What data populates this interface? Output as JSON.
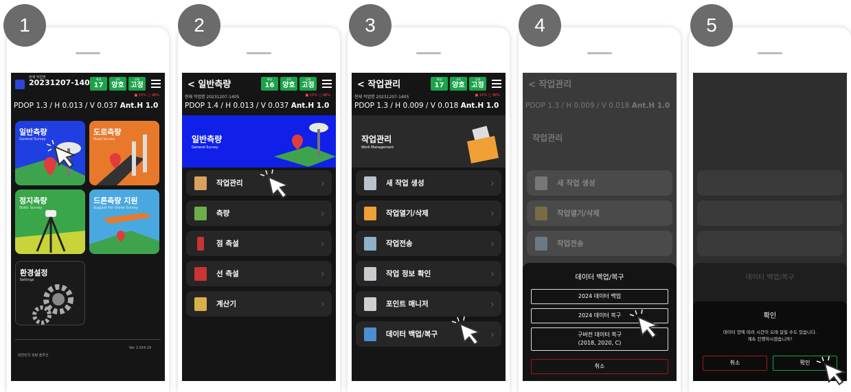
{
  "steps": [
    "1",
    "2",
    "3",
    "4",
    "5"
  ],
  "screen1": {
    "job_label": "현재 작업명",
    "job_name": "20231207-1405",
    "pdop_prefix": "PDOP 1.3 / H 0.013 / V 0.037",
    "ant": "Ant.H 1.0",
    "signal": "■ 15%  □ 98%",
    "badges": [
      {
        "top": "위성",
        "val": "17"
      },
      {
        "top": "고도",
        "val": "양호"
      },
      {
        "top": "상태",
        "val": "고정"
      }
    ],
    "tiles": [
      {
        "title": "일반측량",
        "sub": "General Survey"
      },
      {
        "title": "도로측량",
        "sub": "Road Survey"
      },
      {
        "title": "정지측량",
        "sub": "Static Survey"
      },
      {
        "title": "드론측량 지원",
        "sub": "Support For Drone Survey"
      },
      {
        "title": "환경설정",
        "sub": "Settings"
      }
    ],
    "version": "Ver 2.024.19",
    "footer": "대한민국 측량 솔루션"
  },
  "screen2": {
    "title": "< 일반측량",
    "sub": "현재 작업명 20231207-1405",
    "pdop_prefix": "PDOP 1.4 / H 0.013 / V 0.037",
    "ant": "Ant.H 1.0",
    "badges": [
      {
        "top": "위성",
        "val": "16"
      },
      {
        "top": "고도",
        "val": "양호"
      },
      {
        "top": "상태",
        "val": "고정"
      }
    ],
    "banner_title": "일반측량",
    "banner_sub": "General Survey",
    "menu": [
      "작업관리",
      "측량",
      "점 측설",
      "선 측설",
      "계산기"
    ]
  },
  "screen3": {
    "title": "< 작업관리",
    "sub": "현재 작업명 20231207-1405",
    "pdop_prefix": "PDOP 1.3 / H 0.009 / V 0.018",
    "ant": "Ant.H 1.0",
    "badges": [
      {
        "top": "위성",
        "val": "17"
      },
      {
        "top": "고도",
        "val": "양호"
      },
      {
        "top": "상태",
        "val": "고정"
      }
    ],
    "banner_title": "작업관리",
    "banner_sub": "Work Management",
    "menu": [
      "새 작업 생성",
      "작업열기/삭제",
      "작업전송",
      "작업 정보 확인",
      "포인트 매니저",
      "데이터 백업/복구"
    ]
  },
  "screen4": {
    "sheet_title": "데이터 백업/복구",
    "buttons": [
      "2024 데이터 백업",
      "2024 데이터 복구"
    ],
    "legacy_line1": "구버전 데이터 복구",
    "legacy_line2": "(2018, 2020, C)",
    "cancel": "취소"
  },
  "screen5": {
    "bg_title": "데이터 백업/복구",
    "dialog_title": "확인",
    "dialog_msg1": "데이터 양에 따라 시간이 오래 걸릴 수도 있습니다.",
    "dialog_msg2": "계속 진행하시겠습니까?",
    "cancel": "취소",
    "ok": "확인"
  }
}
